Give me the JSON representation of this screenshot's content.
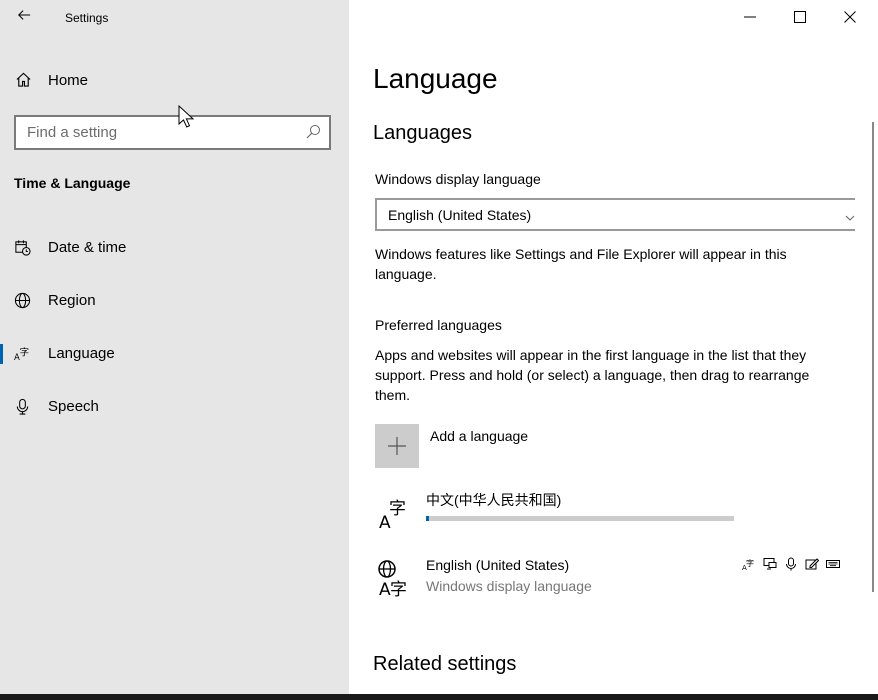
{
  "window": {
    "app_title": "Settings"
  },
  "sidebar": {
    "home_label": "Home",
    "search_placeholder": "Find a setting",
    "section": "Time & Language",
    "items": [
      {
        "label": "Date & time",
        "icon": "calendar-clock-icon",
        "active": false
      },
      {
        "label": "Region",
        "icon": "globe-icon",
        "active": false
      },
      {
        "label": "Language",
        "icon": "language-icon",
        "active": true
      },
      {
        "label": "Speech",
        "icon": "microphone-icon",
        "active": false
      }
    ]
  },
  "main": {
    "page_title": "Language",
    "languages_heading": "Languages",
    "display_language": {
      "label": "Windows display language",
      "value": "English (United States)",
      "description": "Windows features like Settings and File Explorer will appear in this language."
    },
    "preferred": {
      "label": "Preferred languages",
      "description": "Apps and websites will appear in the first language in the list that they support. Press and hold (or select) a language, then drag to rearrange them.",
      "add_label": "Add a language",
      "languages": [
        {
          "name": "中文(中华人民共和国)",
          "download_progress": 0.01
        },
        {
          "name": "English (United States)",
          "subtitle": "Windows display language",
          "features": [
            "language-pack-icon",
            "display-icon",
            "speech-icon",
            "handwriting-icon",
            "keyboard-icon"
          ]
        }
      ]
    },
    "related_heading": "Related settings"
  },
  "colors": {
    "accent": "#0063b1",
    "sidebar_bg": "#e6e6e6",
    "secondary_text": "#767676"
  }
}
